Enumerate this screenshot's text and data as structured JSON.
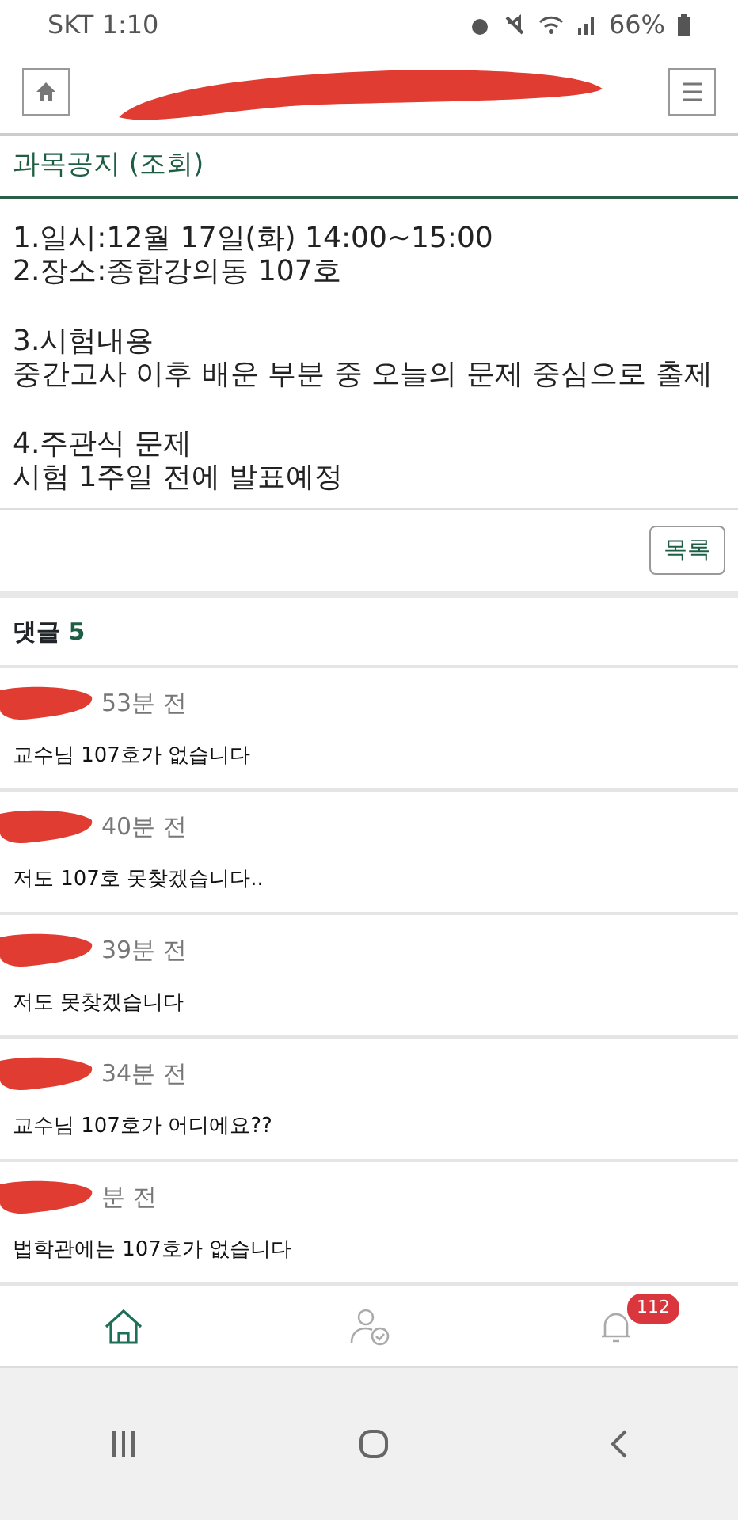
{
  "status_bar": {
    "carrier_time": "SKT 1:10",
    "battery": "66%"
  },
  "page_title": "과목공지 (조회)",
  "notice": {
    "paragraphs": [
      [
        "1.일시:12월 17일(화) 14:00~15:00",
        "2.장소:종합강의동 107호"
      ],
      [
        "3.시험내용",
        "중간고사 이후 배운 부분 중 오늘의 문제 중심으로 출제"
      ],
      [
        "4.주관식 문제",
        "시험 1주일 전에 발표예정"
      ]
    ]
  },
  "list_button": "목록",
  "comments_header": {
    "label": "댓글",
    "count": "5"
  },
  "comments": [
    {
      "time": "53분 전",
      "text": "교수님 107호가 없습니다"
    },
    {
      "time": "40분 전",
      "text": "저도 107호 못찾겠습니다.."
    },
    {
      "time": "39분 전",
      "text": "저도 못찾겠습니다"
    },
    {
      "time": "34분 전",
      "text": "교수님 107호가 어디에요??"
    },
    {
      "time": "분 전",
      "text": "법학관에는 107호가 없습니다"
    }
  ],
  "bottom_nav": [
    {
      "kind": "home",
      "selected": true
    },
    {
      "kind": "person",
      "selected": false
    },
    {
      "kind": "bell",
      "selected": false,
      "badge": "112"
    }
  ]
}
